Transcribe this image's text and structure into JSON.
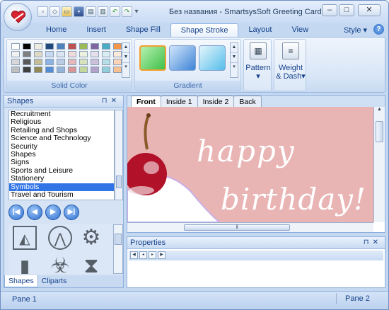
{
  "window": {
    "title": "Без названия - SmartsysSoft Greeting Card..."
  },
  "quick_access": [
    "new-icon",
    "open-icon",
    "open-folder-icon",
    "save-icon",
    "print-preview-icon",
    "print-icon",
    "undo-icon",
    "redo-icon",
    "customize-arrow-icon"
  ],
  "ribbon": {
    "tabs": [
      "Home",
      "Insert",
      "Shape Fill",
      "Shape Stroke",
      "Layout",
      "View"
    ],
    "active_tab": "Shape Stroke",
    "style_label": "Style",
    "groups": {
      "solid_color": "Solid Color",
      "gradient": "Gradient",
      "pattern": "Pattern",
      "weight_dash_line1": "Weight",
      "weight_dash_line2": "& Dash"
    },
    "swatch_colors": [
      "#ffffff",
      "#000000",
      "#eeece1",
      "#1f497d",
      "#4f81bd",
      "#c0504d",
      "#9bbb59",
      "#8064a2",
      "#4bacc6",
      "#f79646",
      "#f2f2f2",
      "#7f7f7f",
      "#ddd9c3",
      "#c6d9f0",
      "#dbe5f1",
      "#f2dcdb",
      "#ebf1dd",
      "#e5e0ec",
      "#dbeef3",
      "#fdeada",
      "#d8d8d8",
      "#595959",
      "#c4bd97",
      "#8db3e2",
      "#b8cce4",
      "#e5b9b7",
      "#d7e3bc",
      "#ccc1d9",
      "#b7dde8",
      "#fbd5b5",
      "#bfbfbf",
      "#3f3f3f",
      "#938953",
      "#548dd4",
      "#95b3d7",
      "#d99694",
      "#c3d69b",
      "#b2a2c7",
      "#92cddc",
      "#fac08f"
    ]
  },
  "shapes_panel": {
    "title": "Shapes",
    "categories": [
      "Recruitment",
      "Religious",
      "Retailing and Shops",
      "Science and Technology",
      "Security",
      "Shapes",
      "Signs",
      "Sports and Leisure",
      "Stationery",
      "Symbols",
      "Travel and Tourism"
    ],
    "selected": "Symbols",
    "tabs": [
      "Shapes",
      "Cliparts"
    ]
  },
  "document": {
    "tabs": [
      "Front",
      "Inside 1",
      "Inside 2",
      "Back"
    ],
    "active_tab": "Front",
    "text_line1": "happy",
    "text_line2": "birthday!"
  },
  "properties": {
    "title": "Properties"
  },
  "status": {
    "pane1": "Pane 1",
    "pane2": "Pane 2"
  }
}
